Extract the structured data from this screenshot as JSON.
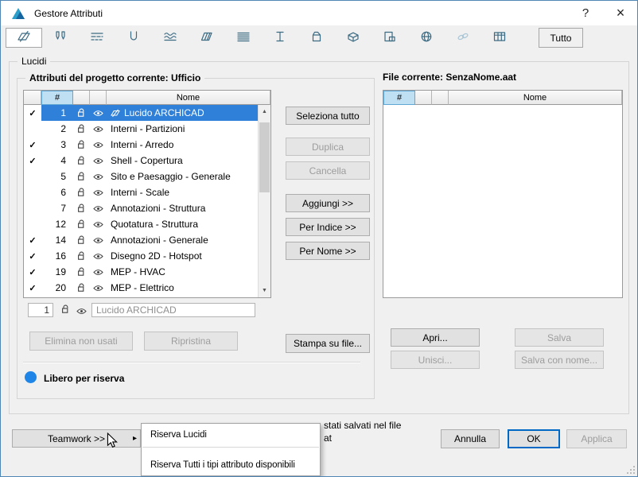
{
  "window": {
    "title": "Gestore Attributi",
    "help_label": "?",
    "close_label": "×"
  },
  "tab_bar": {
    "tabs": [
      {
        "name": "lucidi",
        "active": true
      },
      {
        "name": "penne"
      },
      {
        "name": "tipi-linea"
      },
      {
        "name": "retini"
      },
      {
        "name": "stratificati"
      },
      {
        "name": "profili"
      },
      {
        "name": "superfici"
      },
      {
        "name": "profilo-acciaio"
      },
      {
        "name": "operazioni"
      },
      {
        "name": "materiali"
      },
      {
        "name": "categorie-zona"
      },
      {
        "name": "citta"
      },
      {
        "name": "collegamenti"
      },
      {
        "name": "sistemi-mep"
      }
    ],
    "tutto_label": "Tutto"
  },
  "section_label": "Lucidi",
  "left_panel": {
    "title": "Attributi del progetto corrente: Ufficio",
    "columns": {
      "num": "#",
      "name": "Nome"
    },
    "rows": [
      {
        "check": "✓",
        "num": "1",
        "name": "Lucido ARCHICAD",
        "selected": true
      },
      {
        "check": "",
        "num": "2",
        "name": "Interni - Partizioni"
      },
      {
        "check": "✓",
        "num": "3",
        "name": "Interni - Arredo"
      },
      {
        "check": "✓",
        "num": "4",
        "name": "Shell - Copertura"
      },
      {
        "check": "",
        "num": "5",
        "name": "Sito e Paesaggio - Generale"
      },
      {
        "check": "",
        "num": "6",
        "name": "Interni - Scale"
      },
      {
        "check": "",
        "num": "7",
        "name": "Annotazioni - Struttura"
      },
      {
        "check": "",
        "num": "12",
        "name": "Quotatura - Struttura"
      },
      {
        "check": "✓",
        "num": "14",
        "name": "Annotazioni - Generale"
      },
      {
        "check": "✓",
        "num": "16",
        "name": "Disegno 2D - Hotspot"
      },
      {
        "check": "✓",
        "num": "19",
        "name": "MEP - HVAC"
      },
      {
        "check": "✓",
        "num": "20",
        "name": "MEP - Elettrico"
      }
    ],
    "edit_row": {
      "num": "1",
      "name": "Lucido ARCHICAD"
    },
    "delete_unused_label": "Elimina non usati",
    "restore_label": "Ripristina",
    "legend_label": "Libero per riserva"
  },
  "transfer": {
    "select_all": "Seleziona tutto",
    "duplicate": "Duplica",
    "delete": "Cancella",
    "append": "Aggiungi >>",
    "by_index": "Per Indice >>",
    "by_name": "Per Nome >>",
    "print_to_file": "Stampa su file..."
  },
  "right_panel": {
    "title": "File corrente: SenzaNome.aat",
    "columns": {
      "num": "#",
      "name": "Nome"
    },
    "open_label": "Apri...",
    "save_label": "Salva",
    "merge_label": "Unisci...",
    "save_as_label": "Salva con nome..."
  },
  "bottom": {
    "teamwork_label": "Teamwork >>",
    "menu_items": [
      "Riserva Lucidi",
      "Riserva Tutti i tipi attributo disponibili"
    ],
    "note_fragment_line1": "stati salvati nel file",
    "note_fragment_line2": "at",
    "cancel_label": "Annulla",
    "ok_label": "OK",
    "apply_label": "Applica"
  },
  "colors": {
    "selection": "#2f80d9",
    "reserve_free": "#1f86e8",
    "ok_border": "#0069c5",
    "header_sort": "#bfdff2"
  }
}
